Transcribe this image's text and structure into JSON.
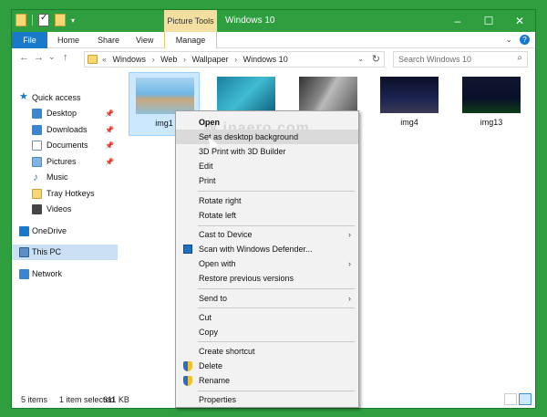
{
  "titlebar": {
    "context_tab": "Picture Tools",
    "title": "Windows 10",
    "minimize": "–",
    "maximize": "☐",
    "close": "✕",
    "qat_dropdown": "▾"
  },
  "ribbon": {
    "tabs": [
      "File",
      "Home",
      "Share",
      "View",
      "Manage"
    ],
    "expand": "⌄",
    "help": "?"
  },
  "address": {
    "back": "←",
    "forward": "→",
    "recent": "⌄",
    "up": "↑",
    "overflow": "«",
    "crumbs": [
      "Windows",
      "Web",
      "Wallpaper",
      "Windows 10"
    ],
    "sep": "›",
    "dropdown": "⌄",
    "refresh": "↻",
    "search_placeholder": "Search Windows 10",
    "search_icon": "⌕"
  },
  "nav": {
    "items": [
      {
        "label": "Quick access",
        "icon": "star-icon"
      },
      {
        "label": "Desktop",
        "icon": "desktop-icon",
        "pinned": true
      },
      {
        "label": "Downloads",
        "icon": "downloads-icon",
        "pinned": true
      },
      {
        "label": "Documents",
        "icon": "documents-icon",
        "pinned": true
      },
      {
        "label": "Pictures",
        "icon": "pictures-icon",
        "pinned": true
      },
      {
        "label": "Music",
        "icon": "music-icon"
      },
      {
        "label": "Tray Hotkeys",
        "icon": "folder-icon"
      },
      {
        "label": "Videos",
        "icon": "videos-icon"
      },
      {
        "label": "OneDrive",
        "icon": "onedrive-icon"
      },
      {
        "label": "This PC",
        "icon": "pc-icon",
        "selected": true
      },
      {
        "label": "Network",
        "icon": "network-icon"
      }
    ],
    "pin_glyph": "📌"
  },
  "files": [
    {
      "name": "img1",
      "selected": true
    },
    {
      "name": "",
      "selected": false
    },
    {
      "name": "",
      "selected": false
    },
    {
      "name": "img4",
      "selected": false
    },
    {
      "name": "img13",
      "selected": false
    }
  ],
  "context_menu": {
    "items": {
      "open": "Open",
      "set_bg": "Set as desktop background",
      "print3d": "3D Print with 3D Builder",
      "edit": "Edit",
      "print": "Print",
      "rotate_right": "Rotate right",
      "rotate_left": "Rotate left",
      "cast": "Cast to Device",
      "defender": "Scan with Windows Defender...",
      "open_with": "Open with",
      "restore": "Restore previous versions",
      "send_to": "Send to",
      "cut": "Cut",
      "copy": "Copy",
      "create_shortcut": "Create shortcut",
      "delete": "Delete",
      "rename": "Rename",
      "properties": "Properties"
    },
    "submenu_arrow": "›",
    "watermark": "W  inaero.com"
  },
  "status": {
    "items": "5 items",
    "selected": "1 item selected",
    "size": "611 KB"
  },
  "colors": {
    "titlebar": "#2e9e3f",
    "file_tab": "#1979ca",
    "context_tab": "#f3e0a0",
    "selection": "#cce8ff"
  }
}
